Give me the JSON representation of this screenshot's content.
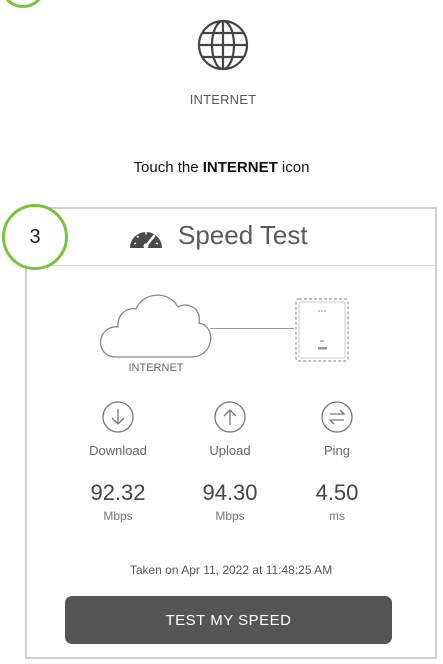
{
  "top": {
    "internet_label": "INTERNET",
    "instruction_prefix": "Touch the ",
    "instruction_bold": "INTERNET",
    "instruction_suffix": " icon"
  },
  "card": {
    "step_number": "3",
    "title": "Speed Test",
    "cloud_label": "INTERNET",
    "metrics": [
      {
        "icon": "arrow-down-circle-icon",
        "label": "Download",
        "value": "92.32",
        "unit": "Mbps"
      },
      {
        "icon": "arrow-up-circle-icon",
        "label": "Upload",
        "value": "94.30",
        "unit": "Mbps"
      },
      {
        "icon": "ping-arrows-circle-icon",
        "label": "Ping",
        "value": "4.50",
        "unit": "ms"
      }
    ],
    "timestamp": "Taken on Apr 11, 2022 at 11:48:25 AM",
    "button_label": "TEST MY SPEED"
  },
  "colors": {
    "accent_green": "#7cc242",
    "button_bg": "#555555"
  }
}
